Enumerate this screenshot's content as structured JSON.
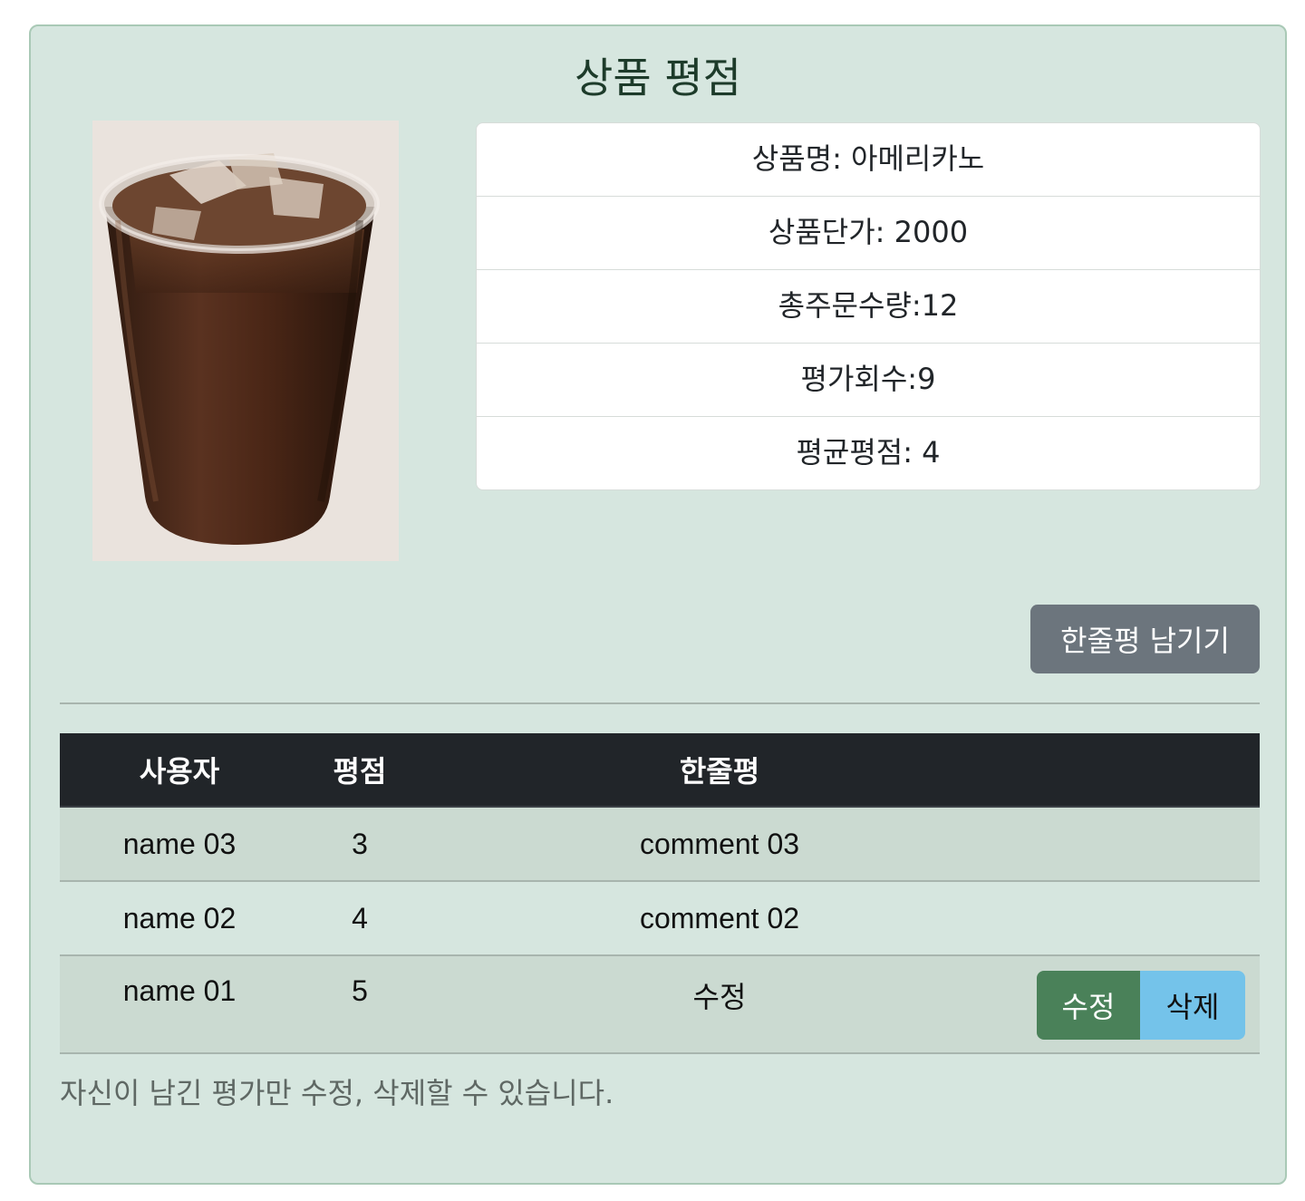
{
  "page": {
    "title": "상품 평점",
    "product_image_alt": "iced-americano"
  },
  "product_info": {
    "name": "상품명: 아메리카노",
    "price": "상품단가: 2000",
    "total_orders": "총주문수량:12",
    "review_count": "평가회수:9",
    "average_rating": "평균평점: 4"
  },
  "actions": {
    "write_review_label": "한줄평 남기기"
  },
  "table": {
    "headers": [
      "사용자",
      "평점",
      "한줄평",
      ""
    ],
    "rows": [
      {
        "user": "name 03",
        "score": "3",
        "comment": "comment 03"
      },
      {
        "user": "name 02",
        "score": "4",
        "comment": "comment 02"
      },
      {
        "user": "name 01",
        "score": "5",
        "comment": "수정",
        "edit_label": "수정",
        "delete_label": "삭제"
      }
    ]
  },
  "footer_note": "자신이 남긴 평가만 수정, 삭제할 수 있습니다.",
  "colors": {
    "card_bg": "#d6e6df",
    "secondary_button": "#6c757d",
    "table_header": "#212529",
    "edit_button": "#4a8159",
    "delete_button": "#74c3ea"
  }
}
